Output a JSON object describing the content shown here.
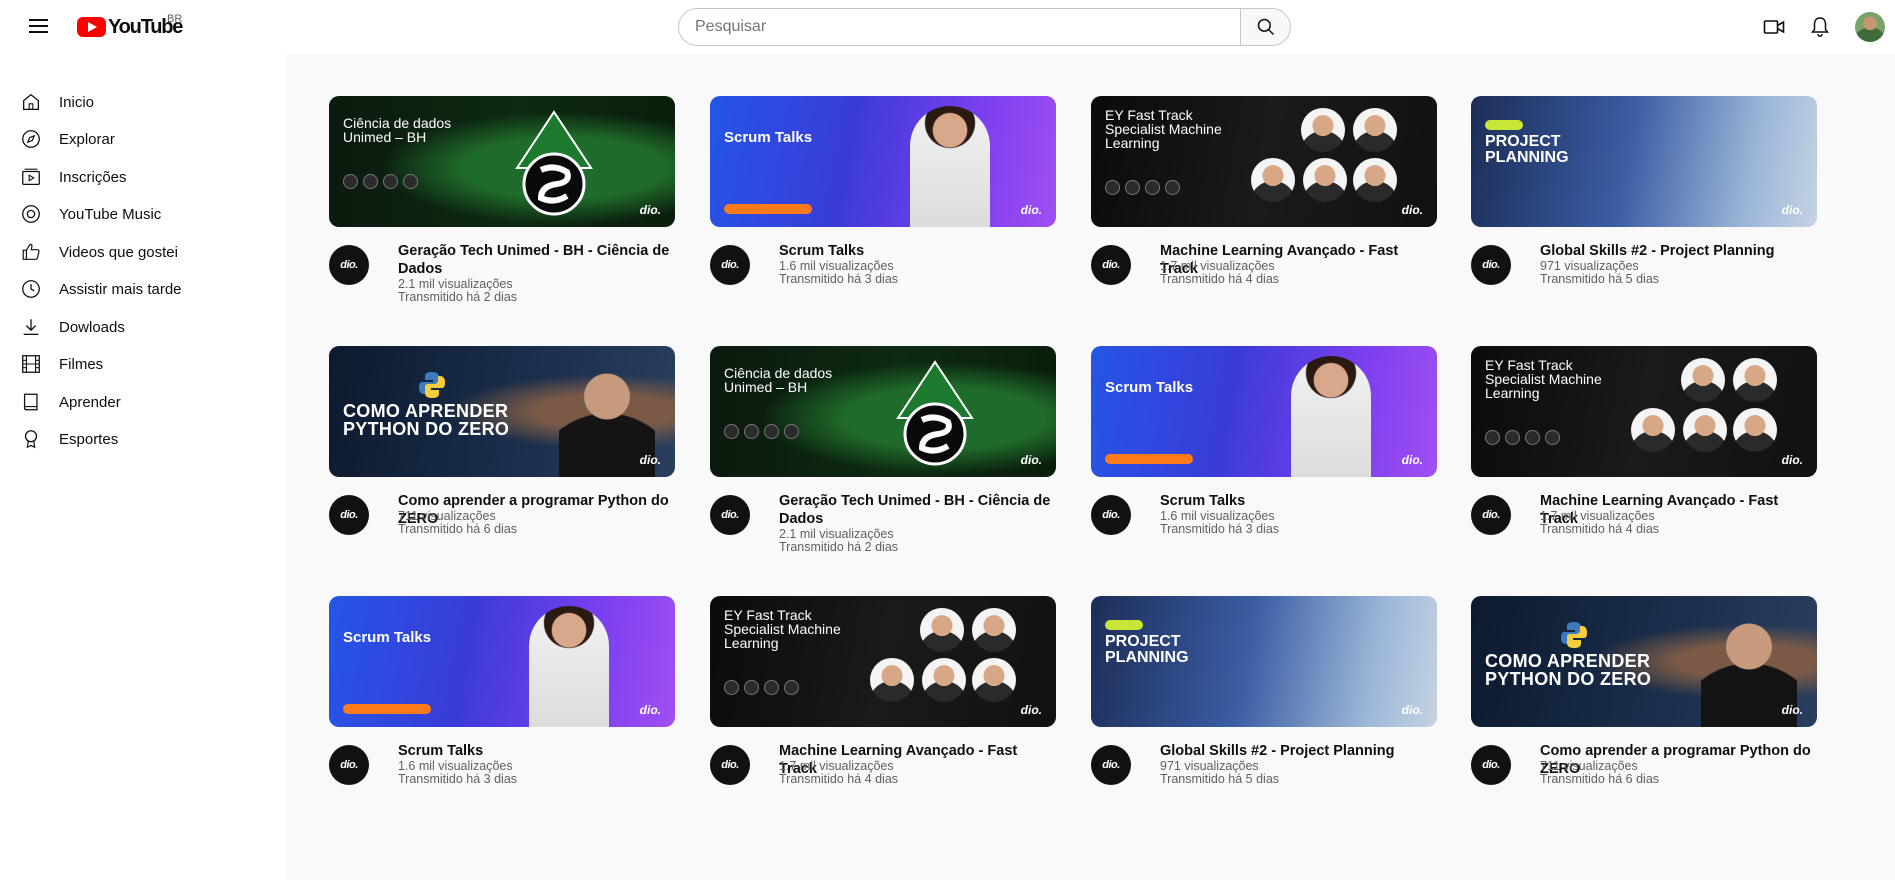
{
  "header": {
    "logo_text": "YouTube",
    "country": "BR",
    "search_placeholder": "Pesquisar"
  },
  "sidebar": {
    "items": [
      {
        "label": "Inicio",
        "icon": "home-icon"
      },
      {
        "label": "Explorar",
        "icon": "compass-icon"
      },
      {
        "label": "Inscrições",
        "icon": "subscriptions-icon"
      },
      {
        "label": "YouTube Music",
        "icon": "music-icon"
      },
      {
        "label": "Videos que gostei",
        "icon": "thumbs-up-icon"
      },
      {
        "label": "Assistir mais tarde",
        "icon": "clock-icon"
      },
      {
        "label": "Dowloads",
        "icon": "download-icon"
      },
      {
        "label": "Filmes",
        "icon": "film-icon"
      },
      {
        "label": "Aprender",
        "icon": "book-icon"
      },
      {
        "label": "Esportes",
        "icon": "trophy-icon"
      }
    ]
  },
  "videos": [
    {
      "title": "Geração Tech Unimed - BH - Ciência de Dados",
      "views": "2.1 mil visualizações",
      "time": "Transmitido há 2 dias",
      "thumb_text": "Ciência de dados\nUnimed – BH",
      "theme": "unimed"
    },
    {
      "title": "Scrum Talks",
      "views": "1.6 mil visualizações",
      "time": "Transmitido há 3 dias",
      "thumb_text": "Scrum Talks",
      "theme": "scrum"
    },
    {
      "title": "Machine Learning Avançado - Fast Track",
      "views": "1.7 mil visualizações",
      "time": "Transmitido há 4 dias",
      "thumb_text": "EY Fast Track\nSpecialist Machine\nLearning",
      "theme": "ml"
    },
    {
      "title": "Global Skills #2 - Project Planning",
      "views": "971 visualizações",
      "time": "Transmitido há 5 dias",
      "thumb_text": "PROJECT\nPLANNING",
      "theme": "gs"
    },
    {
      "title": "Como aprender a programar Python do ZERO",
      "views": "711 visualizações",
      "time": "Transmitido há 6 dias",
      "thumb_text": "COMO APRENDER\nPYTHON DO ZERO",
      "theme": "py"
    },
    {
      "title": "Geração Tech Unimed - BH - Ciência de Dados",
      "views": "2.1 mil visualizações",
      "time": "Transmitido há 2 dias",
      "thumb_text": "Ciência de dados\nUnimed – BH",
      "theme": "unimed"
    },
    {
      "title": "Scrum Talks",
      "views": "1.6 mil visualizações",
      "time": "Transmitido há 3 dias",
      "thumb_text": "Scrum Talks",
      "theme": "scrum"
    },
    {
      "title": "Machine Learning Avançado - Fast Track",
      "views": "1.7 mil visualizações",
      "time": "Transmitido há 4 dias",
      "thumb_text": "EY Fast Track\nSpecialist Machine\nLearning",
      "theme": "ml"
    },
    {
      "title": "Scrum Talks",
      "views": "1.6 mil visualizações",
      "time": "Transmitido há 3 dias",
      "thumb_text": "Scrum Talks",
      "theme": "scrum"
    },
    {
      "title": "Machine Learning Avançado - Fast Track",
      "views": "1.7 mil visualizações",
      "time": "Transmitido há 4 dias",
      "thumb_text": "EY Fast Track\nSpecialist Machine\nLearning",
      "theme": "ml"
    },
    {
      "title": "Global Skills #2 - Project Planning",
      "views": "971 visualizações",
      "time": "Transmitido há 5 dias",
      "thumb_text": "PROJECT\nPLANNING",
      "theme": "gs"
    },
    {
      "title": "Como aprender a programar Python do ZERO",
      "views": "711 visualizações",
      "time": "Transmitido há 6 dias",
      "thumb_text": "COMO APRENDER\nPYTHON DO ZERO",
      "theme": "py"
    }
  ],
  "brand": "dio.",
  "colors": {
    "youtube_red": "#ff0000",
    "background": "#f9f9f9",
    "text": "#0f0f0f",
    "meta": "#606060"
  }
}
